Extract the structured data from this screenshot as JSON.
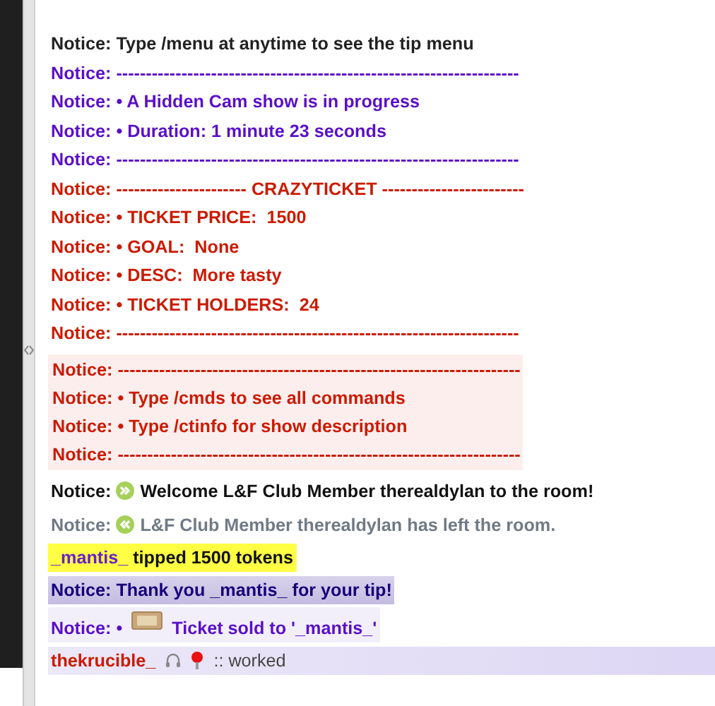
{
  "messages": [
    {
      "kind": "notice",
      "color": "#222222",
      "label": "Notice:",
      "text": "Type /menu at anytime to see the tip menu"
    },
    {
      "kind": "notice",
      "color": "#5a0fc8",
      "label": "Notice:",
      "text": "--------------------------------------------------------------------"
    },
    {
      "kind": "notice",
      "color": "#5a0fc8",
      "label": "Notice:",
      "text": "• A Hidden Cam show is in progress"
    },
    {
      "kind": "notice",
      "color": "#5a0fc8",
      "label": "Notice:",
      "text": "• Duration: 1 minute 23 seconds"
    },
    {
      "kind": "notice",
      "color": "#5a0fc8",
      "label": "Notice:",
      "text": "--------------------------------------------------------------------"
    },
    {
      "kind": "notice",
      "color": "#cc1a00",
      "label": "Notice:",
      "text": "---------------------- CRAZYTICKET ------------------------"
    },
    {
      "kind": "notice",
      "color": "#cc1a00",
      "label": "Notice:",
      "text": "• TICKET PRICE:  1500"
    },
    {
      "kind": "notice",
      "color": "#cc1a00",
      "label": "Notice:",
      "text": "• GOAL:  None"
    },
    {
      "kind": "notice",
      "color": "#cc1a00",
      "label": "Notice:",
      "text": "• DESC:  More tasty"
    },
    {
      "kind": "notice",
      "color": "#cc1a00",
      "label": "Notice:",
      "text": "• TICKET HOLDERS:  24"
    },
    {
      "kind": "notice",
      "color": "#cc1a00",
      "label": "Notice:",
      "text": "--------------------------------------------------------------------"
    },
    {
      "kind": "block",
      "color": "#cc1a00",
      "lines": [
        {
          "label": "Notice:",
          "text": "--------------------------------------------------------------------"
        },
        {
          "label": "Notice:",
          "text": "• Type /cmds to see all commands"
        },
        {
          "label": "Notice:",
          "text": "• Type /ctinfo for show description"
        },
        {
          "label": "Notice:",
          "text": "--------------------------------------------------------------------"
        }
      ]
    },
    {
      "kind": "enter",
      "color": "#111111",
      "label": "Notice:",
      "text": "Welcome L&F Club Member therealdylan to the room!"
    },
    {
      "kind": "leave",
      "color": "#707a86",
      "label": "Notice:",
      "text": "L&F Club Member therealdylan has left the room."
    },
    {
      "kind": "tip",
      "user": "_mantis_",
      "text": "tipped 1500 tokens"
    },
    {
      "kind": "thanks",
      "label": "Notice:",
      "text": "Thank you _mantis_ for your tip!"
    },
    {
      "kind": "ticket",
      "label": "Notice:",
      "bullet": "•",
      "text": "Ticket sold to '_mantis_'"
    },
    {
      "kind": "chat",
      "user": "thekrucible_",
      "text": ":: worked"
    }
  ]
}
